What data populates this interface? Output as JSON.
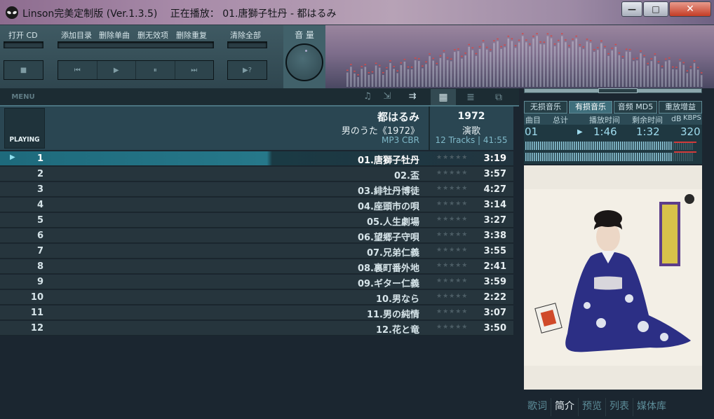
{
  "window": {
    "app_title": "Linson完美定制版 (Ver.1.3.5)",
    "now_playing": "正在播放： 01.唐獅子牡丹 - 都はるみ",
    "controls": {
      "minimize": "—",
      "maximize": "□",
      "close": "✕"
    }
  },
  "toolbar": {
    "open_cd": "打开 CD",
    "add_dir": "添加目录",
    "delete_single": "删除单曲",
    "delete_invalid": "删无效项",
    "delete_dup": "删除重复",
    "clear_all": "清除全部",
    "volume": "音 量",
    "stop": "■",
    "prev": "⏮",
    "play": "▶",
    "pause": "⏸",
    "next": "⏭",
    "playmode": "▶?"
  },
  "playlist_header": {
    "menu": "MENU",
    "icons": [
      "music-note-icon",
      "export-icon",
      "repeat-arrow-icon"
    ],
    "views": [
      "grid-view-icon",
      "list-view-icon",
      "mini-view-icon"
    ]
  },
  "album": {
    "badge": "PLAYING",
    "artist": "都はるみ",
    "title": "男のうた《1972》",
    "format": "MP3 CBR",
    "year": "1972",
    "genre": "演歌",
    "tracks_summary": "12 Tracks | 41:55"
  },
  "tracks": [
    {
      "num": "1",
      "title": "01.唐獅子牡丹",
      "duration": "3:19",
      "active": true
    },
    {
      "num": "2",
      "title": "02.盃",
      "duration": "3:57"
    },
    {
      "num": "3",
      "title": "03.緋牡丹博徒",
      "duration": "4:27"
    },
    {
      "num": "4",
      "title": "04.座頭市の唄",
      "duration": "3:14"
    },
    {
      "num": "5",
      "title": "05.人生劇場",
      "duration": "3:27"
    },
    {
      "num": "6",
      "title": "06.望郷子守唄",
      "duration": "3:38"
    },
    {
      "num": "7",
      "title": "07.兄弟仁義",
      "duration": "3:55"
    },
    {
      "num": "8",
      "title": "08.裏町番外地",
      "duration": "2:41"
    },
    {
      "num": "9",
      "title": "09.ギター仁義",
      "duration": "3:59"
    },
    {
      "num": "10",
      "title": "10.男なら",
      "duration": "2:22"
    },
    {
      "num": "11",
      "title": "11.男の純情",
      "duration": "3:07"
    },
    {
      "num": "12",
      "title": "12.花と竜",
      "duration": "3:50"
    }
  ],
  "rating_glyph": "★★★★★",
  "dsp": {
    "lossless": "无损音乐",
    "lossy": "有损音乐",
    "md5": "音频 MD5",
    "replay_gain": "重放增益"
  },
  "stats": {
    "labels": {
      "track": "曲目",
      "total": "总计",
      "elapsed": "播放时间",
      "remaining": "剩余时间",
      "db": "dB",
      "kbps": "KBPS"
    },
    "track_no": "01",
    "play_icon": "▶",
    "elapsed": "1:46",
    "remaining": "1:32",
    "bitrate": "320"
  },
  "bottom_tabs": [
    "歌词",
    "简介",
    "预览",
    "列表",
    "媒体库"
  ],
  "active_tab": 1,
  "colors": {
    "accent": "#26788a",
    "panel": "#2d444c",
    "text_dim": "#5c8c98"
  }
}
